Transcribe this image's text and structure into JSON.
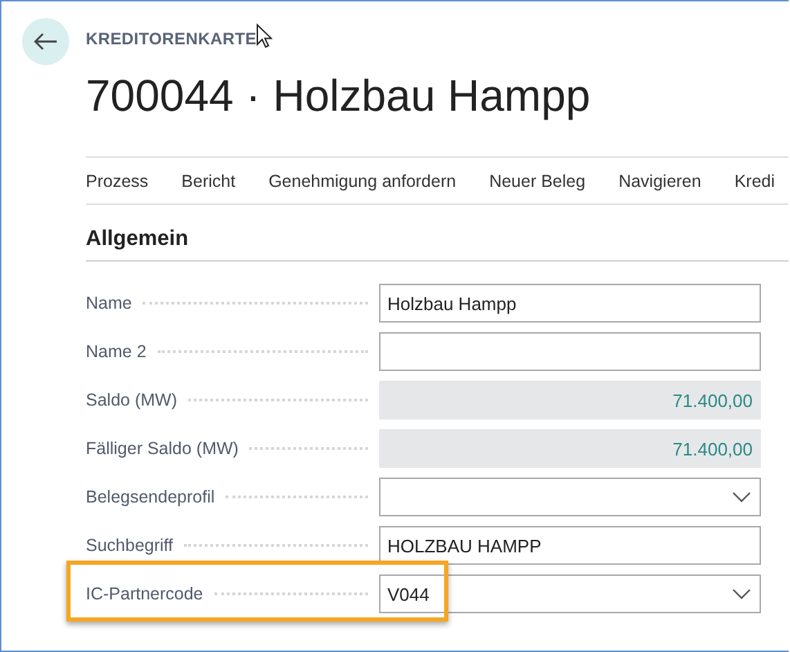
{
  "page": {
    "caption": "KREDITORENKARTE",
    "title": "700044 · Holzbau Hampp"
  },
  "actions": [
    "Prozess",
    "Bericht",
    "Genehmigung anfordern",
    "Neuer Beleg",
    "Navigieren",
    "Kredi"
  ],
  "section": {
    "title": "Allgemein"
  },
  "fields": [
    {
      "label": "Name",
      "kind": "text",
      "value": "Holzbau Hampp",
      "highlighted": false
    },
    {
      "label": "Name 2",
      "kind": "text",
      "highlighted": false
    },
    {
      "label": "Saldo (MW)",
      "kind": "readonly",
      "value": "71.400,00",
      "highlighted": false
    },
    {
      "label": "Fälliger Saldo (MW)",
      "kind": "readonly",
      "value": "71.400,00",
      "highlighted": false
    },
    {
      "label": "Belegsendeprofil",
      "kind": "dropdown",
      "highlighted": false
    },
    {
      "label": "Suchbegriff",
      "kind": "text",
      "value": "HOLZBAU HAMPP",
      "highlighted": false
    },
    {
      "label": "IC-Partnercode",
      "kind": "dropdown",
      "value": "V044",
      "highlighted": true
    }
  ]
}
